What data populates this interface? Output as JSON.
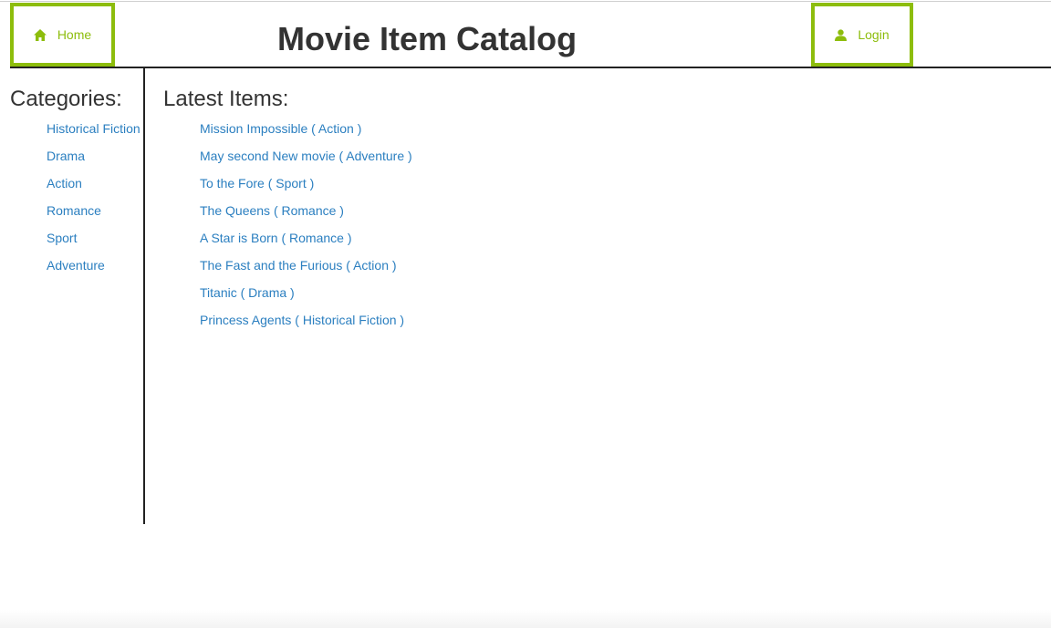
{
  "header": {
    "home_label": "Home",
    "login_label": "Login",
    "title": "Movie Item Catalog",
    "accent_color": "#8dbd0c"
  },
  "sidebar": {
    "heading": "Categories:",
    "items": [
      {
        "label": "Historical Fiction"
      },
      {
        "label": "Drama"
      },
      {
        "label": "Action"
      },
      {
        "label": "Romance"
      },
      {
        "label": "Sport"
      },
      {
        "label": "Adventure"
      }
    ]
  },
  "main": {
    "heading": "Latest Items:",
    "items": [
      {
        "label": "Mission Impossible ( Action )"
      },
      {
        "label": "May second New movie ( Adventure )"
      },
      {
        "label": "To the Fore ( Sport )"
      },
      {
        "label": "The Queens ( Romance )"
      },
      {
        "label": "A Star is Born ( Romance )"
      },
      {
        "label": "The Fast and the Furious ( Action )"
      },
      {
        "label": "Titanic ( Drama )"
      },
      {
        "label": "Princess Agents ( Historical Fiction )"
      }
    ]
  },
  "icons": {
    "home": "home-icon",
    "login": "user-icon"
  },
  "colors": {
    "link": "#2b7fc0",
    "text": "#333333",
    "divider": "#222222"
  }
}
